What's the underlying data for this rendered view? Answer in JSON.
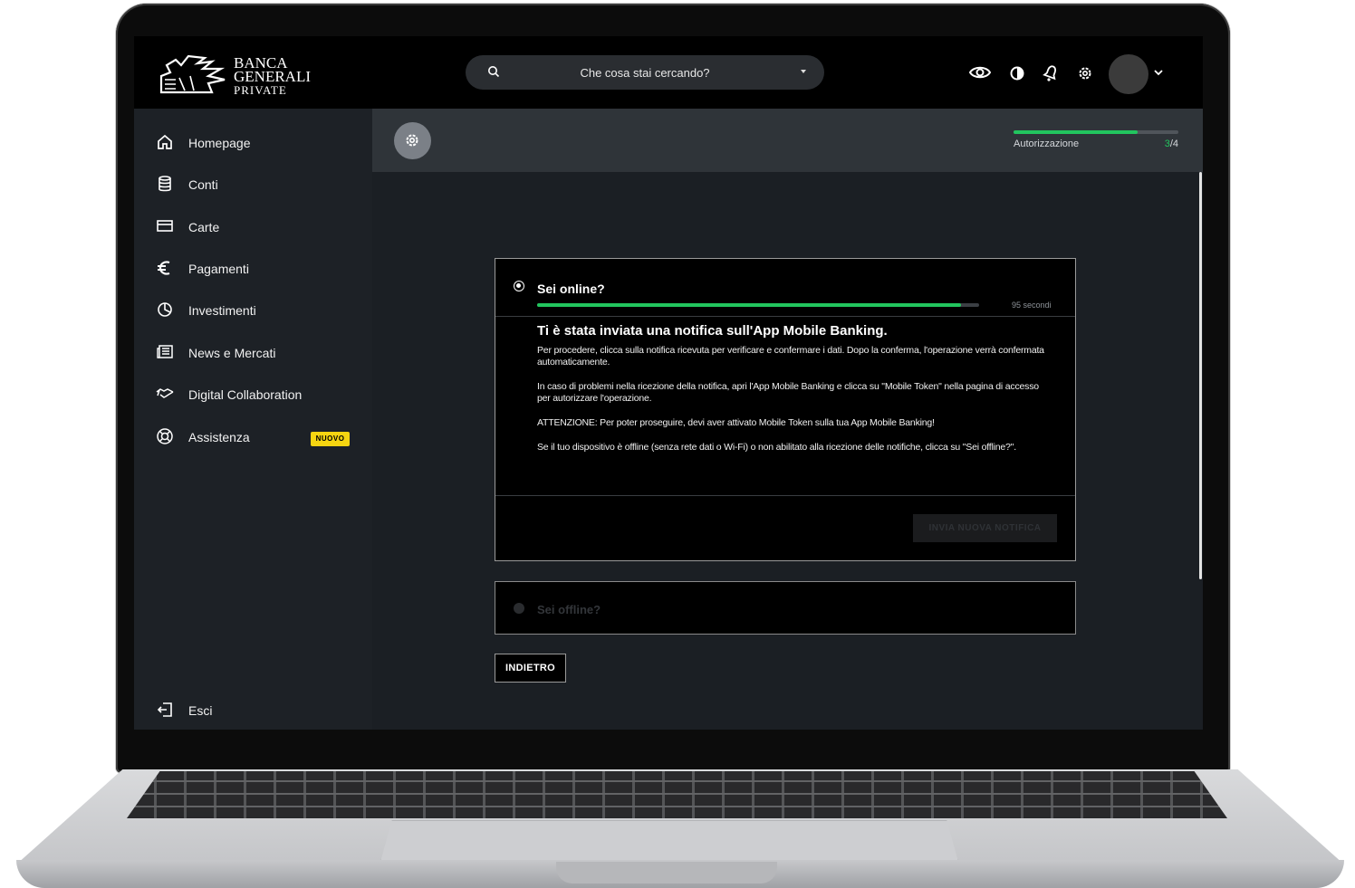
{
  "brand": {
    "logo_line1": "BANCA",
    "logo_line2": "GENERALI",
    "logo_line3": "PRIVATE"
  },
  "search": {
    "placeholder": "Che cosa stai cercando?"
  },
  "header_icons": [
    "eye-icon",
    "contrast-icon",
    "bell-icon",
    "gear-icon",
    "avatar",
    "chevron-down-icon"
  ],
  "sidebar": {
    "items": [
      {
        "label": "Homepage",
        "icon": "home-icon"
      },
      {
        "label": "Conti",
        "icon": "coins-icon"
      },
      {
        "label": "Carte",
        "icon": "card-icon"
      },
      {
        "label": "Pagamenti",
        "icon": "euro-icon"
      },
      {
        "label": "Investimenti",
        "icon": "pie-chart-icon"
      },
      {
        "label": "News e Mercati",
        "icon": "newspaper-icon"
      },
      {
        "label": "Digital Collaboration",
        "icon": "handshake-icon"
      },
      {
        "label": "Assistenza",
        "icon": "lifebuoy-icon",
        "badge": "NUOVO"
      }
    ],
    "logout_label": "Esci"
  },
  "progress": {
    "label": "Autorizzazione",
    "current": "3",
    "total": "/4",
    "fraction": 0.75
  },
  "online": {
    "title": "Sei online?",
    "timer_label": "95 secondi",
    "timer_fraction": 0.96,
    "notification_title": "Ti è stata inviata una notifica sull'App Mobile Banking.",
    "paragraphs": [
      "Per procedere, clicca sulla notifica ricevuta per verificare e confermare i dati. Dopo la conferma, l'operazione verrà confermata automaticamente.",
      "In caso di problemi nella ricezione della notifica, apri l'App Mobile Banking e clicca su \"Mobile Token\" nella pagina di accesso per autorizzare l'operazione.",
      "ATTENZIONE: Per poter proseguire, devi aver attivato Mobile Token sulla tua App Mobile Banking!",
      "Se il tuo dispositivo è offline (senza rete dati o Wi-Fi) o non abilitato alla ricezione delle notifiche, clicca su \"Sei offline?\"."
    ],
    "resend_label": "INVIA NUOVA NOTIFICA"
  },
  "offline": {
    "title": "Sei offline?"
  },
  "back_label": "INDIETRO",
  "colors": {
    "accent_green": "#22c55e",
    "badge_yellow": "#f6d511",
    "sidebar_bg": "#1d2126"
  }
}
